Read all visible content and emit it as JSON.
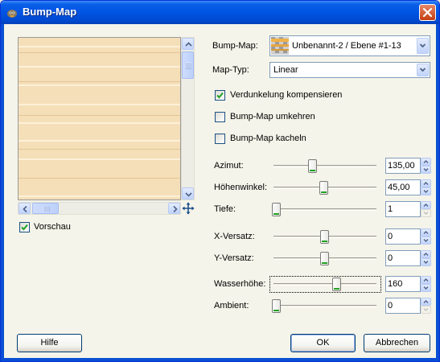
{
  "window": {
    "title": "Bump-Map"
  },
  "preview": {
    "checkbox_label": "Vorschau",
    "checked": true
  },
  "bumpmap": {
    "label": "Bump-Map:",
    "value": "Unbenannt-2 / Ebene #1-13"
  },
  "maptype": {
    "label": "Map-Typ:",
    "value": "Linear"
  },
  "options": [
    {
      "label": "Verdunkelung kompensieren",
      "checked": true
    },
    {
      "label": "Bump-Map umkehren",
      "checked": false
    },
    {
      "label": "Bump-Map kacheln",
      "checked": false
    }
  ],
  "sliders": [
    {
      "label": "Azimut:",
      "value": "135,00",
      "min": 0,
      "max": 360,
      "numeric": 135
    },
    {
      "label": "Höhenwinkel:",
      "value": "45,00",
      "min": 0.5,
      "max": 90,
      "numeric": 45
    },
    {
      "label": "Tiefe:",
      "value": "1",
      "min": 1,
      "max": 65,
      "numeric": 1
    },
    {
      "label": "X-Versatz:",
      "value": "0",
      "min": -1000,
      "max": 1000,
      "numeric": 0
    },
    {
      "label": "Y-Versatz:",
      "value": "0",
      "min": -1000,
      "max": 1000,
      "numeric": 0
    },
    {
      "label": "Wasserhöhe:",
      "value": "160",
      "min": 0,
      "max": 255,
      "numeric": 160
    },
    {
      "label": "Ambient:",
      "value": "0",
      "min": 0,
      "max": 255,
      "numeric": 0
    }
  ],
  "buttons": {
    "help": "Hilfe",
    "ok": "OK",
    "cancel": "Abbrechen"
  },
  "colors": {
    "titlebar": "#0054e3",
    "preview_fill": "#f5dfb9",
    "dialog_bg": "#f5f4ea"
  }
}
